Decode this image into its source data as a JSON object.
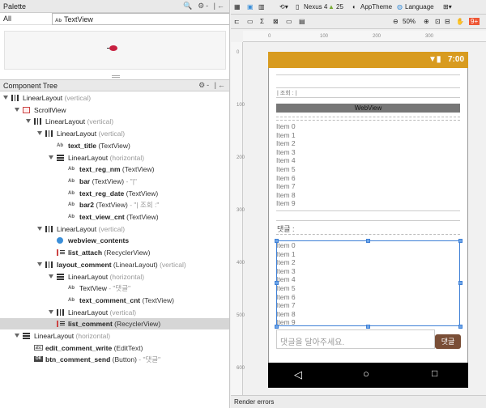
{
  "palette": {
    "title": "Palette",
    "tools": "🔍 ⚙- |←",
    "filter_all": "All",
    "selected_widget": "TextView",
    "ab_icon": "Ab"
  },
  "component_tree": {
    "title": "Component Tree",
    "tools": "⚙- |←",
    "rows": [
      {
        "name": "LinearLayout",
        "type": "",
        "hint": "(vertical)",
        "icon": "vertical-linear-layout-icon",
        "indent": 0,
        "expand": true,
        "bold": false
      },
      {
        "name": "ScrollView",
        "type": "",
        "hint": "",
        "icon": "scroll-view-icon",
        "indent": 1,
        "expand": true,
        "bold": false
      },
      {
        "name": "LinearLayout",
        "type": "",
        "hint": "(vertical)",
        "icon": "vertical-linear-layout-icon",
        "indent": 2,
        "expand": true,
        "bold": false
      },
      {
        "name": "LinearLayout",
        "type": "",
        "hint": "(vertical)",
        "icon": "vertical-linear-layout-icon",
        "indent": 3,
        "expand": true,
        "bold": false
      },
      {
        "name": "text_title",
        "type": "(TextView)",
        "hint": "",
        "icon": "text-view-icon",
        "indent": 4,
        "expand": false,
        "bold": true
      },
      {
        "name": "LinearLayout",
        "type": "",
        "hint": "(horizontal)",
        "icon": "horizontal-linear-layout-icon",
        "indent": 4,
        "expand": true,
        "bold": false
      },
      {
        "name": "text_reg_nm",
        "type": "(TextView)",
        "hint": "",
        "icon": "text-view-icon",
        "indent": 5,
        "expand": false,
        "bold": true
      },
      {
        "name": "bar",
        "type": "(TextView)",
        "hint": "- \"|\"",
        "icon": "text-view-icon",
        "indent": 5,
        "expand": false,
        "bold": true
      },
      {
        "name": "text_reg_date",
        "type": "(TextView)",
        "hint": "",
        "icon": "text-view-icon",
        "indent": 5,
        "expand": false,
        "bold": true
      },
      {
        "name": "bar2",
        "type": "(TextView)",
        "hint": "- \"| 조회 :\"",
        "icon": "text-view-icon",
        "indent": 5,
        "expand": false,
        "bold": true
      },
      {
        "name": "text_view_cnt",
        "type": "(TextView)",
        "hint": "",
        "icon": "text-view-icon",
        "indent": 5,
        "expand": false,
        "bold": true
      },
      {
        "name": "LinearLayout",
        "type": "",
        "hint": "(vertical)",
        "icon": "vertical-linear-layout-icon",
        "indent": 3,
        "expand": true,
        "bold": false
      },
      {
        "name": "webview_contents",
        "type": "",
        "hint": "",
        "icon": "web-view-icon",
        "indent": 4,
        "expand": false,
        "bold": true
      },
      {
        "name": "list_attach",
        "type": "(RecyclerView)",
        "hint": "",
        "icon": "recycler-view-icon",
        "indent": 4,
        "expand": false,
        "bold": true
      },
      {
        "name": "layout_comment",
        "type": "(LinearLayout)",
        "hint": "(vertical)",
        "icon": "vertical-linear-layout-icon",
        "indent": 3,
        "expand": true,
        "bold": true
      },
      {
        "name": "LinearLayout",
        "type": "",
        "hint": "(horizontal)",
        "icon": "horizontal-linear-layout-icon",
        "indent": 4,
        "expand": true,
        "bold": false
      },
      {
        "name": "TextView",
        "type": "",
        "hint": "- \"댓글\"",
        "icon": "text-view-icon",
        "indent": 5,
        "expand": false,
        "bold": false
      },
      {
        "name": "text_comment_cnt",
        "type": "(TextView)",
        "hint": "",
        "icon": "text-view-icon",
        "indent": 5,
        "expand": false,
        "bold": true
      },
      {
        "name": "LinearLayout",
        "type": "",
        "hint": "(vertical)",
        "icon": "vertical-linear-layout-icon",
        "indent": 4,
        "expand": true,
        "bold": false
      },
      {
        "name": "list_comment",
        "type": "(RecyclerView)",
        "hint": "",
        "icon": "recycler-view-icon",
        "indent": 4,
        "expand": false,
        "bold": true,
        "selected": true
      },
      {
        "name": "LinearLayout",
        "type": "",
        "hint": "(horizontal)",
        "icon": "horizontal-linear-layout-icon",
        "indent": 1,
        "expand": true,
        "bold": false
      },
      {
        "name": "edit_comment_write",
        "type": "(EditText)",
        "hint": "",
        "icon": "edit-text-icon",
        "indent": 2,
        "expand": false,
        "bold": true
      },
      {
        "name": "btn_comment_send",
        "type": "(Button)",
        "hint": "- \"댓글\"",
        "icon": "button-icon",
        "indent": 2,
        "expand": false,
        "bold": true
      }
    ]
  },
  "toolbar": {
    "device": "Nexus 4",
    "api": "25",
    "theme": "AppTheme",
    "language": "Language",
    "zoom": "50%"
  },
  "ruler": {
    "h_ticks": [
      "0",
      "100",
      "200",
      "300"
    ],
    "v_ticks": [
      "0",
      "100",
      "200",
      "300",
      "400",
      "500",
      "600"
    ]
  },
  "device_screen": {
    "time": "7:00",
    "meta_row": "| 조회 : |",
    "webview_label": "WebView",
    "attach_items": [
      "Item 0",
      "Item 1",
      "Item 2",
      "Item 3",
      "Item 4",
      "Item 5",
      "Item 6",
      "Item 7",
      "Item 8",
      "Item 9"
    ],
    "comment_label": "댓글 :",
    "comment_items": [
      "Item 0",
      "Item 1",
      "Item 2",
      "Item 3",
      "Item 4",
      "Item 5",
      "Item 6",
      "Item 7",
      "Item 8",
      "Item 9"
    ],
    "comment_placeholder": "댓글을 달아주세요.",
    "send_button": "댓글"
  },
  "render_errors": "Render errors"
}
